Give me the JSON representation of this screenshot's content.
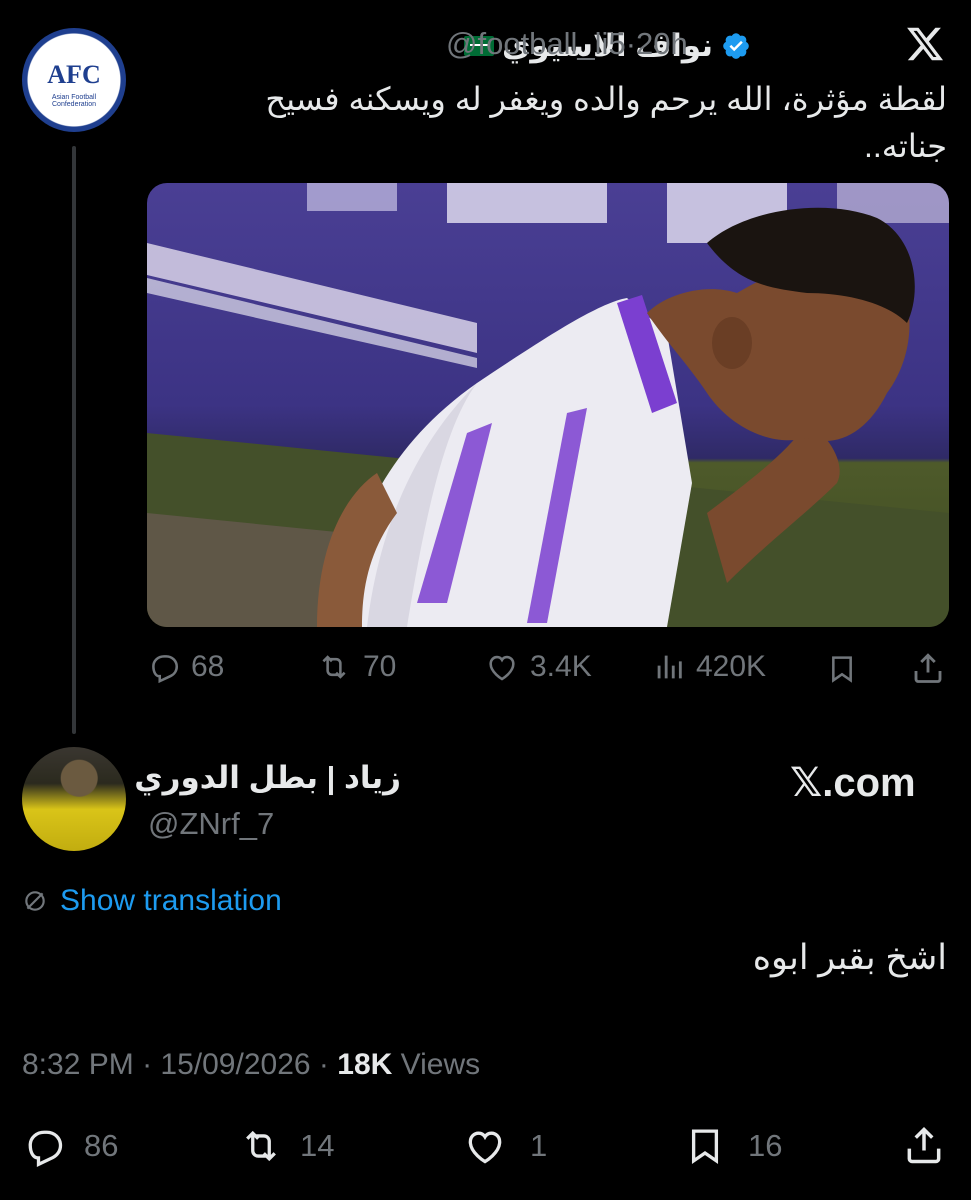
{
  "quoted": {
    "display_name": "نواف الاسيوي",
    "handle": "@football_li5",
    "separator": "·",
    "time": "20h",
    "text": "لقطة مؤثرة، الله يرحم والده ويغفر له ويسكنه فسيح جناته..",
    "avatar_text": "AFC",
    "avatar_subtext": "Asian Football Confederation",
    "media_icon": "video-still",
    "stats": {
      "replies": "68",
      "reposts": "70",
      "likes": "3.4K",
      "views": "420K"
    }
  },
  "reply": {
    "display_name": "زياد | بطل الدوري",
    "handle": "@ZNrf_7",
    "watermark": "𝕏.com",
    "show_translation": "Show translation",
    "text": "اشخ بقبر ابوه",
    "time": "8:32 PM",
    "sep1": "·",
    "date": "15/09/2026",
    "sep2": "·",
    "views_count": "18K",
    "views_label": "Views",
    "stats": {
      "replies": "86",
      "reposts": "14",
      "likes": "1",
      "bookmarks": "16"
    }
  },
  "colors": {
    "background": "#000000",
    "text": "#e7e9ea",
    "secondary": "#71767b",
    "link": "#1d9bf0",
    "verified": "#1d9bf0"
  }
}
